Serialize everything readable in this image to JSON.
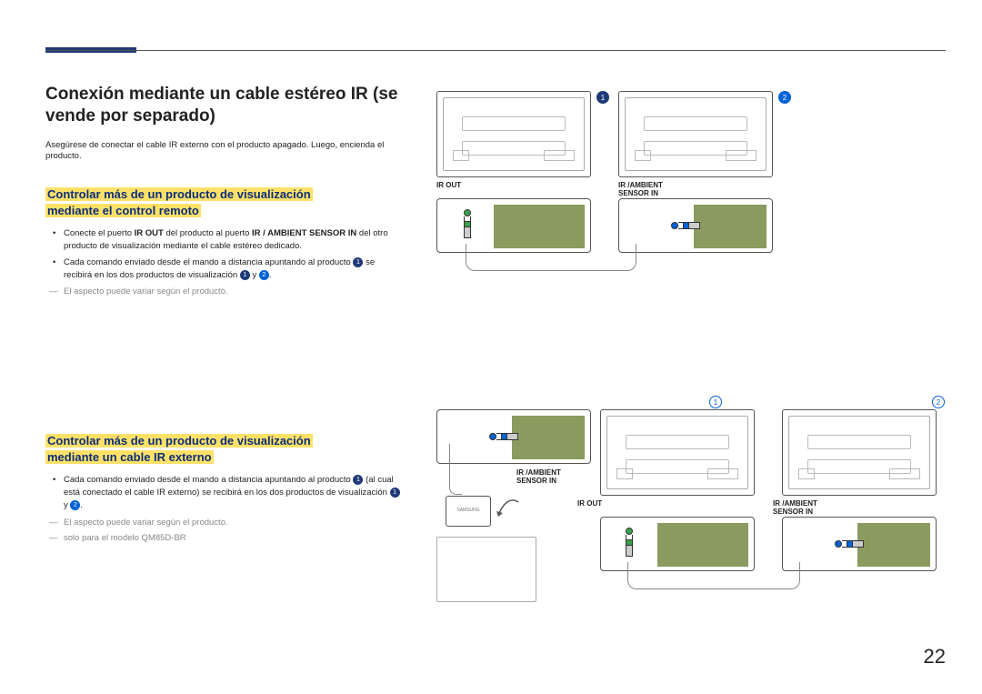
{
  "pageNumber": "22",
  "heading": "Conexión mediante un cable estéreo IR (se vende por separado)",
  "intro": "Asegúrese de conectar el cable IR externo con el producto apagado. Luego, encienda el producto.",
  "section1": {
    "title_line1": "Controlar más de un producto de visualización",
    "title_line2": "mediante el control remoto",
    "bullet1_a": "Conecte el puerto ",
    "bullet1_b1": "IR OUT",
    "bullet1_c": " del producto al puerto ",
    "bullet1_b2": "IR / AMBIENT SENSOR IN",
    "bullet1_d": " del otro producto de visualización mediante el cable estéreo dedicado.",
    "bullet2_a": "Cada comando enviado desde el mando a distancia apuntando al producto ",
    "bullet2_b": " se recibirá en los dos productos de visualización ",
    "bullet2_c": " y ",
    "bullet2_d": ".",
    "note": "El aspecto puede variar según el producto."
  },
  "section2": {
    "title_line1": "Controlar más de un producto de visualización",
    "title_line2": "mediante un cable IR externo",
    "bullet1_a": "Cada comando enviado desde el mando a distancia apuntando al producto ",
    "bullet1_b": " (al cual está conectado el cable IR externo) se recibirá en los dos productos de visualización ",
    "bullet1_c": " y ",
    "bullet1_d": ".",
    "note1": "El aspecto puede variar según el producto.",
    "note2": "solo para el modelo QM85D-BR"
  },
  "labels": {
    "irout": "IR OUT",
    "irambient_a": "IR /AMBIENT",
    "irambient_b": "SENSOR IN",
    "brand": "SAMSUNG",
    "d1": "1",
    "d2": "2"
  }
}
